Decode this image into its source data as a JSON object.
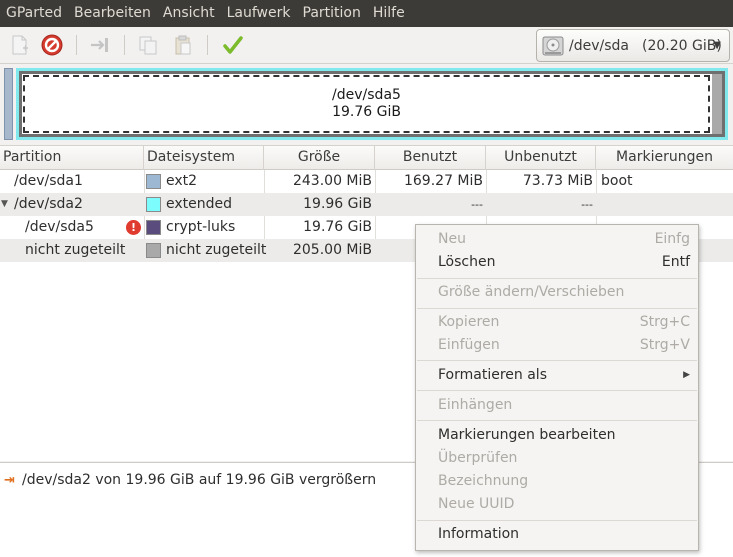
{
  "menubar": {
    "items": [
      "GParted",
      "Bearbeiten",
      "Ansicht",
      "Laufwerk",
      "Partition",
      "Hilfe"
    ]
  },
  "toolbar": {
    "buttons": [
      {
        "icon": "new-partition-icon"
      },
      {
        "icon": "delete-icon"
      },
      {
        "icon": "resize-move-icon"
      },
      {
        "icon": "copy-icon"
      },
      {
        "icon": "paste-icon"
      },
      {
        "icon": "apply-icon"
      }
    ],
    "device": {
      "name": "/dev/sda",
      "size": "(20.20 GiB)"
    }
  },
  "visual": {
    "partition_name": "/dev/sda5",
    "partition_size": "19.76 GiB"
  },
  "table": {
    "headers": [
      "Partition",
      "Dateisystem",
      "Größe",
      "Benutzt",
      "Unbenutzt",
      "Markierungen"
    ],
    "rows": [
      {
        "partition": "/dev/sda1",
        "fs": "ext2",
        "size": "243.00 MiB",
        "used": "169.27 MiB",
        "unused": "73.73 MiB",
        "flags": "boot",
        "color": "#9db8d2"
      },
      {
        "partition": "/dev/sda2",
        "fs": "extended",
        "size": "19.96 GiB",
        "used": "---",
        "unused": "---",
        "flags": "",
        "color": "#7dfcfe"
      },
      {
        "partition": "/dev/sda5",
        "fs": "crypt-luks",
        "size": "19.76 GiB",
        "used": "",
        "unused": "",
        "flags": "",
        "color": "#5a4c7c"
      },
      {
        "partition": "nicht zugeteilt",
        "fs": "nicht zugeteilt",
        "size": "205.00 MiB",
        "used": "",
        "unused": "",
        "flags": "",
        "color": "#a9a9a9"
      }
    ]
  },
  "operations": {
    "items": [
      "/dev/sda2 von 19.96 GiB auf 19.96 GiB vergrößern"
    ]
  },
  "context_menu": {
    "items": [
      {
        "label": "Neu",
        "accel": "Einfg"
      },
      {
        "label": "Löschen",
        "accel": "Entf"
      },
      {
        "label": "Größe ändern/Verschieben",
        "accel": ""
      },
      {
        "label": "Kopieren",
        "accel": "Strg+C"
      },
      {
        "label": "Einfügen",
        "accel": "Strg+V"
      },
      {
        "label": "Formatieren als",
        "accel": ""
      },
      {
        "label": "Einhängen",
        "accel": ""
      },
      {
        "label": "Markierungen bearbeiten",
        "accel": ""
      },
      {
        "label": "Überprüfen",
        "accel": ""
      },
      {
        "label": "Bezeichnung",
        "accel": ""
      },
      {
        "label": "Neue UUID",
        "accel": ""
      },
      {
        "label": "Information",
        "accel": ""
      }
    ]
  }
}
